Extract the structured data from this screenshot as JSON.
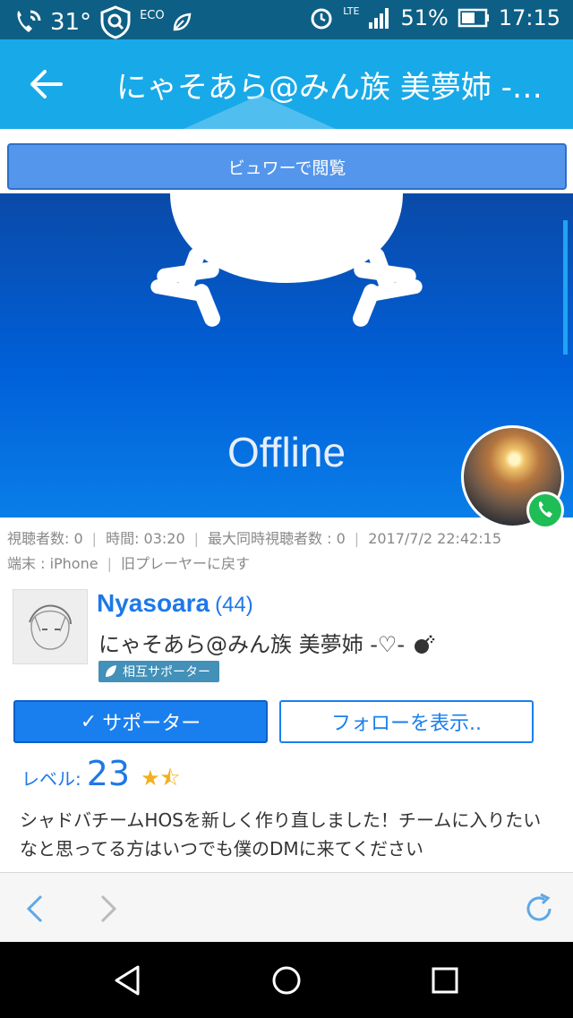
{
  "status_bar": {
    "temperature": "31°",
    "eco_label": "ECO",
    "network": "LTE",
    "battery": "51%",
    "time": "17:15"
  },
  "app_bar": {
    "back_icon": "arrow-left",
    "title": "にゃそあら@みん族 美夢姉 -♡- 💣"
  },
  "viewer_button": {
    "label": "ビュワーで閲覧"
  },
  "video": {
    "offline_text": "Offline"
  },
  "stats": {
    "viewers": "視聴者数: 0",
    "time": "時間: 03:20",
    "max_viewers": "最大同時視聴者数 : 0",
    "date": "2017/7/2 22:42:15",
    "device": "端末 : iPhone",
    "old_player": "旧プレーヤーに戻す"
  },
  "profile": {
    "name": "Nyasoara",
    "level_paren": "(44)",
    "subtitle": "にゃそあら@みん族 美夢姉 -♡-",
    "mutual_badge": "相互サポーター"
  },
  "buttons": {
    "supporter_check": "✓",
    "supporter": "サポーター",
    "follow": "フォローを表示.."
  },
  "level": {
    "label": "レベル:",
    "value": "23",
    "stars": "★⯪",
    "rating": 1.5
  },
  "description": "シャドバチームHOSを新しく作り直しました！チームに入りたいなと思ってる方はいつでも僕のDMに来てください",
  "colors": {
    "status_bar": "#0d5f85",
    "app_bar": "#18a9e8",
    "accent": "#1a7fee",
    "call_green": "#1fbd55"
  }
}
